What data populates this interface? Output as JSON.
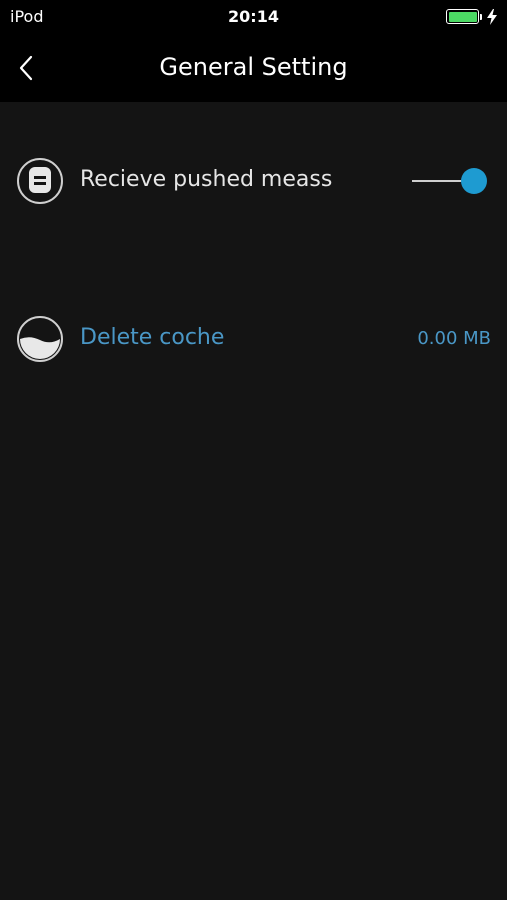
{
  "status_bar": {
    "carrier": "iPod",
    "time": "20:14",
    "battery_color": "#4cd964"
  },
  "nav": {
    "title": "General Setting",
    "back_icon": "chevron-left-icon"
  },
  "settings": {
    "push": {
      "label": "Recieve pushed meass",
      "icon": "message-icon",
      "toggle_on": true,
      "toggle_color": "#1e9bd1"
    },
    "cache": {
      "label": "Delete coche",
      "value": "0.00 MB",
      "icon": "storage-icon",
      "accent_color": "#4a97c6"
    }
  }
}
